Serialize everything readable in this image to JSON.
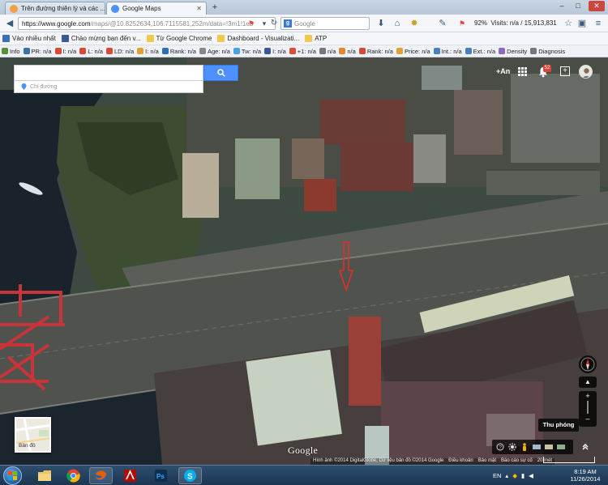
{
  "browser": {
    "tabs": [
      {
        "title": "Trên đường thiên lý và các ...",
        "favicon_color": "#f0a046",
        "active": false
      },
      {
        "title": "Google Maps",
        "favicon_color": "#4d90fe",
        "active": true
      }
    ],
    "new_tab_label": "+",
    "window_buttons": {
      "minimize": "–",
      "maximize": "□",
      "close": "✕"
    },
    "url": {
      "domain": "https://www.google.com",
      "path": "/maps/@10.8252634,106.7115581,252m/data=!3m1!1e3"
    },
    "search_placeholder": "Google",
    "stats": {
      "zoom": "92%",
      "visits": "Visits: n/a / 15,913,831"
    }
  },
  "bookmarks": [
    {
      "label": "Vào nhiều nhất",
      "color": "#3b6fb6"
    },
    {
      "label": "Chào mừng bạn đến v...",
      "color": "#3b5998"
    },
    {
      "label": "Từ Google Chrome",
      "color": "#f2c94c"
    },
    {
      "label": "Dashboard - Visualizati...",
      "color": "#f2c94c"
    },
    {
      "label": "ATP",
      "color": "#f2c94c"
    }
  ],
  "seo_toolbar": [
    {
      "label": "Info",
      "color": "#5a8f3a"
    },
    {
      "label": "PR: n/a",
      "color": "#3a6fb0"
    },
    {
      "label": "I: n/a",
      "color": "#d84a36"
    },
    {
      "label": "L: n/a",
      "color": "#d84a36"
    },
    {
      "label": "LD: n/a",
      "color": "#d84a36"
    },
    {
      "label": "I: n/a",
      "color": "#e0a236"
    },
    {
      "label": "Rank: n/a",
      "color": "#2f6fb0"
    },
    {
      "label": "Age: n/a",
      "color": "#888888"
    },
    {
      "label": "Tw: n/a",
      "color": "#4aa3df"
    },
    {
      "label": "I: n/a",
      "color": "#3b5998"
    },
    {
      "label": "+1: n/a",
      "color": "#dd4b39"
    },
    {
      "label": "n/a",
      "color": "#777777"
    },
    {
      "label": "n/a",
      "color": "#e08a2e"
    },
    {
      "label": "Rank: n/a",
      "color": "#d84a36"
    },
    {
      "label": "Price: n/a",
      "color": "#e0a236"
    },
    {
      "label": "Int.: n/a",
      "color": "#4a7fc0"
    },
    {
      "label": "Ext.: n/a",
      "color": "#4a7fc0"
    },
    {
      "label": "Density",
      "color": "#8a6bbf"
    },
    {
      "label": "Diagnosis",
      "color": "#777777"
    }
  ],
  "maps": {
    "search_value": "",
    "directions_label": "Chỉ đường",
    "account_name": "+An",
    "notification_count": "52",
    "zoom_tooltip": "Thu phóng",
    "earth_label": "Bản đồ",
    "logo": "Google",
    "attribution": [
      "Hình ảnh ©2014 DigitalGlobe, Dữ liệu bản đồ ©2014 Google",
      "Điều khoản",
      "Bảo mật",
      "Báo cáo sự cố",
      "20 mét"
    ]
  },
  "taskbar": {
    "apps": [
      "windows-explorer",
      "chrome",
      "firefox",
      "acrobat",
      "photoshop",
      "skype"
    ],
    "language": "EN",
    "time": "8:19 AM",
    "date": "11/26/2014"
  }
}
